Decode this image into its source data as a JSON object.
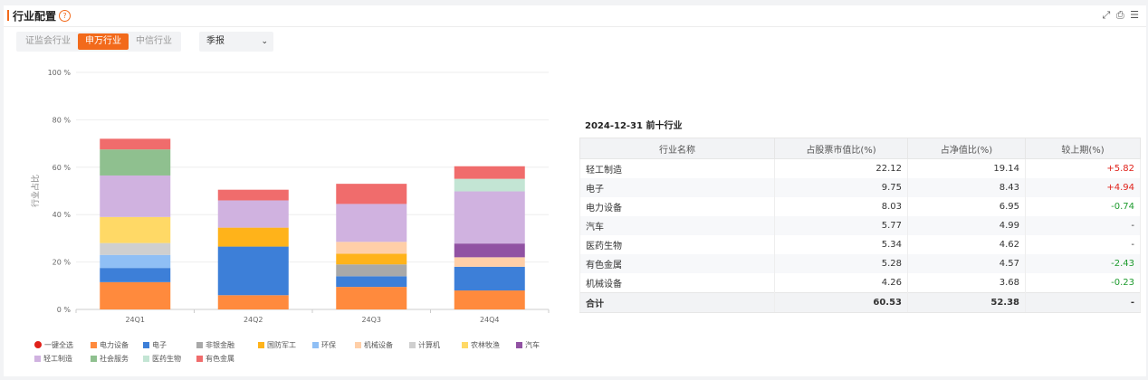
{
  "header": {
    "title": "行业配置",
    "help_icon": "?"
  },
  "tabs": [
    {
      "label": "证监会行业",
      "active": false
    },
    {
      "label": "申万行业",
      "active": true
    },
    {
      "label": "中信行业",
      "active": false
    }
  ],
  "period_select": {
    "value": "季报"
  },
  "chart_data": {
    "type": "bar",
    "stacked": true,
    "ylabel": "行业占比",
    "ylim": [
      0,
      100
    ],
    "yticks": [
      "0 %",
      "20 %",
      "40 %",
      "60 %",
      "80 %",
      "100 %"
    ],
    "categories": [
      "24Q1",
      "24Q2",
      "24Q3",
      "24Q4"
    ],
    "series": [
      {
        "name": "电力设备",
        "color": "#ff8a3d",
        "values": [
          11.5,
          6.0,
          9.5,
          8.0
        ]
      },
      {
        "name": "电子",
        "color": "#3d7fd8",
        "values": [
          6.0,
          20.5,
          4.5,
          10.0
        ]
      },
      {
        "name": "非银金融",
        "color": "#a9a9a9",
        "values": [
          0,
          0,
          5.0,
          0
        ]
      },
      {
        "name": "国防军工",
        "color": "#ffb31a",
        "values": [
          0,
          8.0,
          4.5,
          0
        ]
      },
      {
        "name": "环保",
        "color": "#8fbff5",
        "values": [
          5.5,
          0,
          0,
          0
        ]
      },
      {
        "name": "机械设备",
        "color": "#ffcfa8",
        "values": [
          0,
          0,
          5.0,
          4.0
        ]
      },
      {
        "name": "计算机",
        "color": "#cfcfcf",
        "values": [
          5.0,
          0,
          0,
          0
        ]
      },
      {
        "name": "农林牧渔",
        "color": "#ffd966",
        "values": [
          11.0,
          0,
          0,
          0
        ]
      },
      {
        "name": "汽车",
        "color": "#9152a3",
        "values": [
          0,
          0,
          0,
          5.8
        ]
      },
      {
        "name": "轻工制造",
        "color": "#d0b2e0",
        "values": [
          17.5,
          11.5,
          16.0,
          22.0
        ]
      },
      {
        "name": "社会服务",
        "color": "#8fc08f",
        "values": [
          11.0,
          0,
          0,
          0
        ]
      },
      {
        "name": "医药生物",
        "color": "#c3e5d4",
        "values": [
          0,
          0,
          0,
          5.3
        ]
      },
      {
        "name": "有色金属",
        "color": "#f06c6c",
        "values": [
          4.5,
          4.5,
          8.5,
          5.3
        ]
      }
    ]
  },
  "legend": {
    "select_all": "一键全选",
    "select_all_color": "#e0211a"
  },
  "table": {
    "title": "2024-12-31 前十行业",
    "columns": [
      "行业名称",
      "占股票市值比(%)",
      "占净值比(%)",
      "较上期(%)"
    ],
    "rows": [
      {
        "name": "轻工制造",
        "stock_pct": "22.12",
        "nav_pct": "19.14",
        "change": "+5.82",
        "trend": "pos"
      },
      {
        "name": "电子",
        "stock_pct": "9.75",
        "nav_pct": "8.43",
        "change": "+4.94",
        "trend": "pos"
      },
      {
        "name": "电力设备",
        "stock_pct": "8.03",
        "nav_pct": "6.95",
        "change": "-0.74",
        "trend": "neg"
      },
      {
        "name": "汽车",
        "stock_pct": "5.77",
        "nav_pct": "4.99",
        "change": "-",
        "trend": "none"
      },
      {
        "name": "医药生物",
        "stock_pct": "5.34",
        "nav_pct": "4.62",
        "change": "-",
        "trend": "none"
      },
      {
        "name": "有色金属",
        "stock_pct": "5.28",
        "nav_pct": "4.57",
        "change": "-2.43",
        "trend": "neg"
      },
      {
        "name": "机械设备",
        "stock_pct": "4.26",
        "nav_pct": "3.68",
        "change": "-0.23",
        "trend": "neg"
      }
    ],
    "total": {
      "name": "合计",
      "stock_pct": "60.53",
      "nav_pct": "52.38",
      "change": "-"
    }
  }
}
